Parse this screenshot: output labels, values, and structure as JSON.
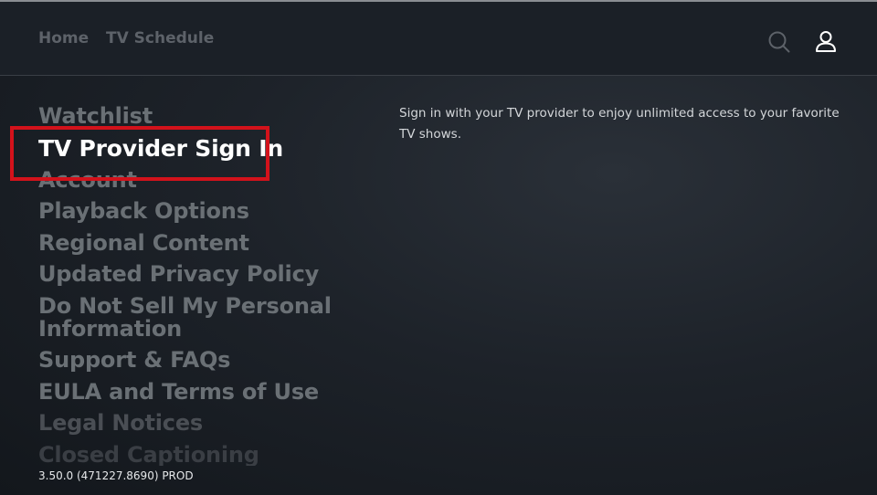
{
  "header": {
    "nav": [
      {
        "label": "Home"
      },
      {
        "label": "TV Schedule"
      }
    ],
    "icons": {
      "search": "search-icon",
      "profile": "profile-icon"
    }
  },
  "settings_menu": {
    "selected_index": 1,
    "items": [
      {
        "label": "Watchlist"
      },
      {
        "label": "TV Provider Sign In"
      },
      {
        "label": "Account"
      },
      {
        "label": "Playback Options"
      },
      {
        "label": "Regional Content"
      },
      {
        "label": "Updated Privacy Policy"
      },
      {
        "label": "Do Not Sell My Personal Information"
      },
      {
        "label": "Support & FAQs"
      },
      {
        "label": "EULA and Terms of Use"
      },
      {
        "label": "Legal Notices"
      },
      {
        "label": "Closed Captioning"
      }
    ]
  },
  "description": "Sign in with your TV provider to enjoy unlimited access to your favorite TV shows.",
  "version": "3.50.0 (471227.8690) PROD",
  "colors": {
    "highlight": "#d3121b",
    "selected_text": "#ffffff",
    "menu_text": "#6a7075",
    "background": "#1b2027"
  }
}
